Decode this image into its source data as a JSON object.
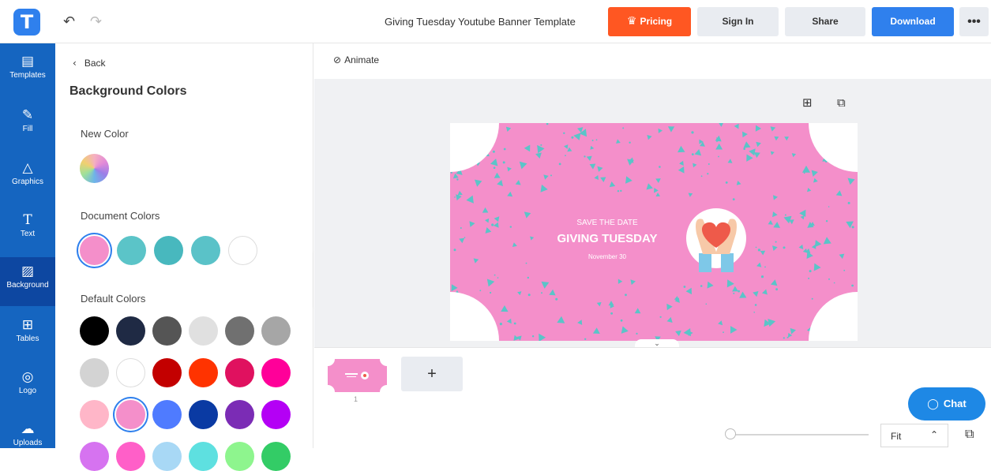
{
  "header": {
    "logo": "T",
    "undo_icon": "undo-icon",
    "redo_icon": "redo-icon",
    "document_title": "Giving Tuesday Youtube Banner Template",
    "pricing_label": "Pricing",
    "signin_label": "Sign In",
    "share_label": "Share",
    "download_label": "Download",
    "more_label": "•••"
  },
  "sidebar": {
    "items": [
      {
        "label": "Templates",
        "icon": "templates-icon"
      },
      {
        "label": "Fill",
        "icon": "brush-icon"
      },
      {
        "label": "Graphics",
        "icon": "shapes-icon"
      },
      {
        "label": "Text",
        "icon": "text-icon"
      },
      {
        "label": "Background",
        "icon": "background-icon",
        "active": true
      },
      {
        "label": "Tables",
        "icon": "table-icon"
      },
      {
        "label": "Logo",
        "icon": "logo-icon"
      },
      {
        "label": "Uploads",
        "icon": "upload-icon"
      }
    ]
  },
  "panel": {
    "back_label": "Back",
    "title": "Background Colors",
    "new_color_label": "New Color",
    "document_colors_label": "Document Colors",
    "default_colors_label": "Default Colors",
    "document_colors": [
      "#f48fca",
      "#5bc4c8",
      "#48b8be",
      "#5ac2c8",
      "#ffffff"
    ],
    "default_colors": [
      [
        "#000000",
        "#1f2a44",
        "#555555",
        "#e0e0e0",
        "#707070",
        "#a6a6a6"
      ],
      [
        "#d3d3d3",
        "#ffffff",
        "#c30000",
        "#ff3300",
        "#e0115f",
        "#ff0099"
      ],
      [
        "#ffb6c8",
        "#f48fca",
        "#4f7bff",
        "#0a3aa3",
        "#7b2cb5",
        "#b400f5"
      ],
      [
        "#d673f0",
        "#ff5fc8",
        "#a8d8f5",
        "#5ee0e0",
        "#8ef58e",
        "#33cc66"
      ]
    ]
  },
  "workspace": {
    "animate_label": "Animate"
  },
  "canvas": {
    "line1": "SAVE THE DATE",
    "line2": "GIVING TUESDAY",
    "line3": "November 30",
    "background_color": "#f48fca",
    "pattern_color": "#5bc4c8"
  },
  "pages": {
    "page_number": "1",
    "add_label": "+"
  },
  "chat": {
    "label": "Chat"
  },
  "zoom": {
    "value": "Fit"
  }
}
